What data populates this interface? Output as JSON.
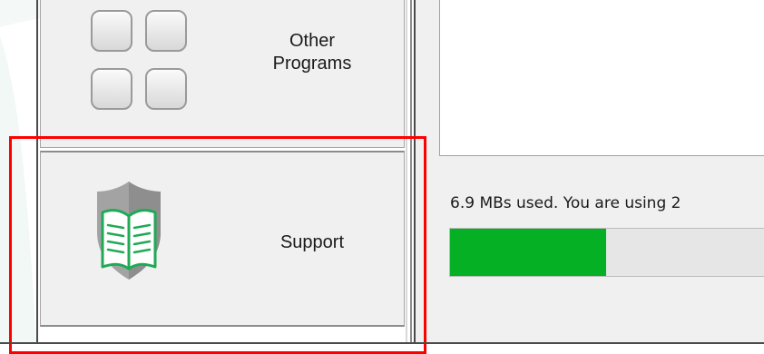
{
  "nav": {
    "other_programs_label": "Other\nPrograms",
    "support_label": "Support"
  },
  "storage": {
    "usage_text": "6.9 MBs used. You are using 2",
    "used_fraction": 0.48
  },
  "colors": {
    "progress_fill": "#06b025",
    "highlight": "#ff0000",
    "book_green": "#1faa55",
    "shield_gray": "#9a9a9a"
  },
  "icons": {
    "other_programs": "app-grid-icon",
    "support": "shield-book-icon"
  }
}
